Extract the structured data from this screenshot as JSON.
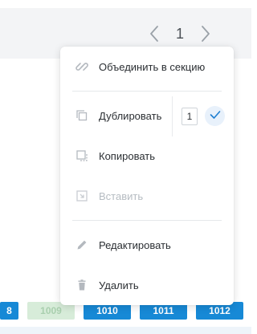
{
  "pagination": {
    "current_page": "1"
  },
  "menu": {
    "merge_label": "Объединить в секцию",
    "duplicate_label": "Дублировать",
    "duplicate_count": "1",
    "copy_label": "Копировать",
    "paste_label": "Вставить",
    "edit_label": "Редактировать",
    "delete_label": "Удалить"
  },
  "bottom_tags": [
    "8",
    "1009",
    "1010",
    "1011",
    "1012"
  ],
  "colors": {
    "accent": "#1789d6",
    "tag_inactive": "#d7ecd9",
    "menu_icon": "#b4b9bf",
    "confirm": "#1f7fd1"
  }
}
